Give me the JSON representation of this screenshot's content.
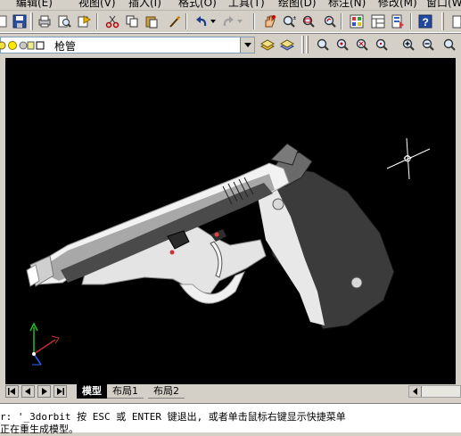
{
  "menubar": {
    "items": [
      "编辑(E)",
      "视图(V)",
      "插入(I)",
      "格式(O)",
      "工具(T)",
      "绘图(D)",
      "标注(N)",
      "修改(M)",
      "窗口(W)"
    ]
  },
  "toolbar1": {
    "icons": [
      "save-icon",
      "print-icon",
      "plot-preview-icon",
      "publish-icon",
      "cut-icon",
      "copy-icon",
      "paste-icon",
      "match-properties-icon",
      "undo-icon",
      "redo-icon",
      "pan-icon",
      "zoom-realtime-icon",
      "zoom-window-icon",
      "zoom-previous-icon",
      "properties-icon",
      "design-center-icon",
      "tool-palettes-icon",
      "help-icon"
    ]
  },
  "layer": {
    "current": "枪管"
  },
  "toolbar2": {
    "icons": [
      "layer-manager-icon",
      "layer-previous-icon",
      "zoom-window-icon",
      "zoom-dynamic-icon",
      "zoom-scale-icon",
      "zoom-center-icon",
      "zoom-in-icon",
      "zoom-out-icon"
    ]
  },
  "tabs": {
    "model": "模型",
    "layout1": "布局1",
    "layout2": "布局2"
  },
  "command": {
    "line1": "r: '_3dorbit 按 ESC 或 ENTER 键退出, 或者单击鼠标右键显示快捷菜单",
    "line2": "正在重生成模型。"
  },
  "colors": {
    "viewport_bg": "#000000",
    "ui_bg": "#d4d0c8",
    "model_light": "#e6e6e6",
    "model_dark": "#3a3a3a"
  }
}
